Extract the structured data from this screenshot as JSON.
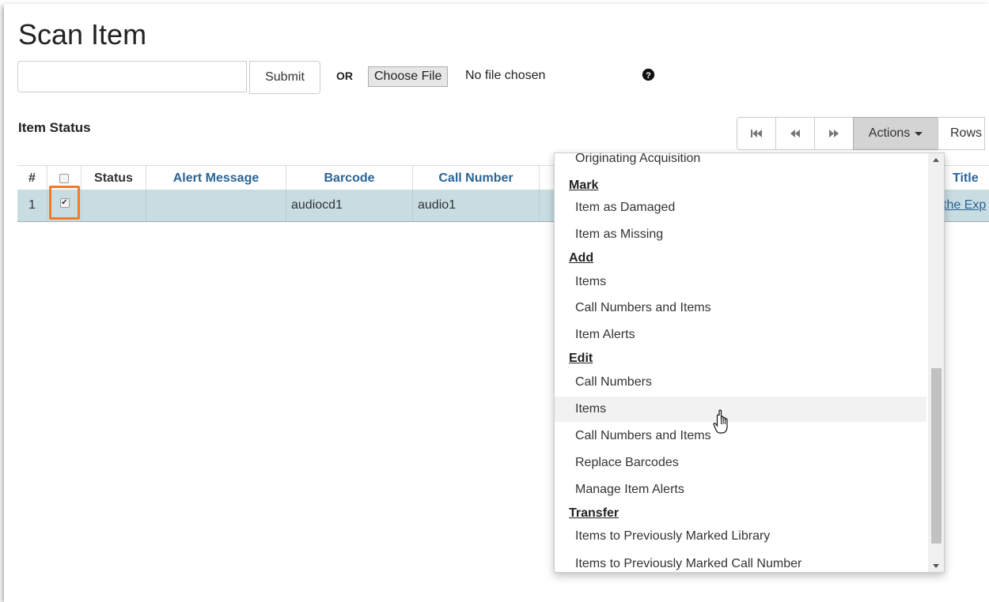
{
  "page": {
    "title": "Scan Item",
    "submit_label": "Submit",
    "or_label": "OR",
    "choose_file_label": "Choose File",
    "no_file_text": "No file chosen",
    "help_icon": "question-circle-icon",
    "section_title": "Item Status"
  },
  "toolbar": {
    "first_icon": "first-page-icon",
    "prev_icon": "previous-page-icon",
    "next_icon": "next-page-icon",
    "actions_label": "Actions",
    "rows_label": "Rows"
  },
  "grid": {
    "headers": {
      "index": "#",
      "status": "Status",
      "alert": "Alert Message",
      "barcode": "Barcode",
      "call_number": "Call Number",
      "title": "Title"
    },
    "rows": [
      {
        "index": "1",
        "checked": true,
        "status": "",
        "alert": "",
        "barcode": "audiocd1",
        "call_number": "audio1",
        "title_visible": "the Exp"
      }
    ]
  },
  "dropdown": {
    "partial_top_item": "Originating Acquisition",
    "sections": [
      {
        "heading": "Mark",
        "items": [
          "Item as Damaged",
          "Item as Missing"
        ]
      },
      {
        "heading": "Add",
        "items": [
          "Items",
          "Call Numbers and Items",
          "Item Alerts"
        ]
      },
      {
        "heading": "Edit",
        "items": [
          "Call Numbers",
          "Items",
          "Call Numbers and Items",
          "Replace Barcodes",
          "Manage Item Alerts"
        ]
      },
      {
        "heading": "Transfer",
        "items": [
          "Items to Previously Marked Library",
          "Items to Previously Marked Call Number"
        ]
      }
    ],
    "hovered_item": "Items"
  },
  "colors": {
    "selected_row": "#c8dde2",
    "highlight_border": "#f07b2a",
    "link": "#2a6496",
    "actions_button": "#d4d4d4"
  }
}
